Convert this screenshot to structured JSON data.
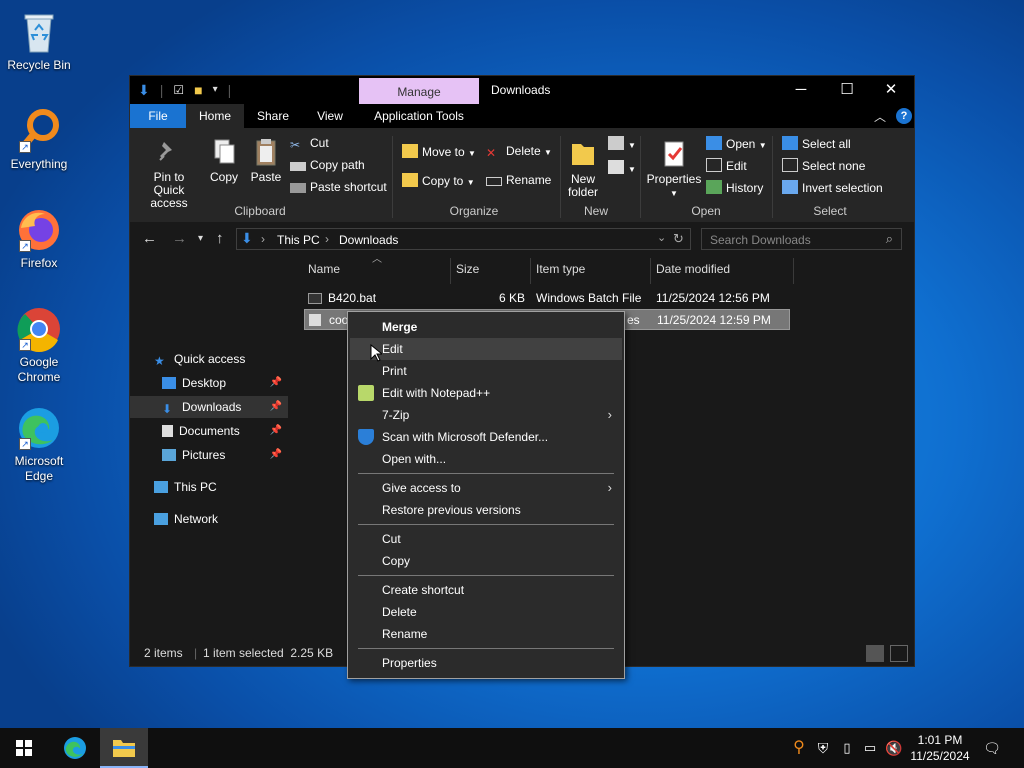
{
  "desktop": {
    "icons": [
      {
        "label": "Recycle Bin"
      },
      {
        "label": "Everything"
      },
      {
        "label": "Firefox"
      },
      {
        "label": "Google Chrome"
      },
      {
        "label": "Microsoft Edge"
      }
    ]
  },
  "window": {
    "title": "Downloads",
    "manage_tab": "Manage",
    "controls": {
      "minimize": "─",
      "maximize": "☐",
      "close": "✕"
    },
    "tabs": [
      "File",
      "Home",
      "Share",
      "View",
      "Application Tools"
    ],
    "ribbon": {
      "clipboard": {
        "pin": "Pin to Quick access",
        "copy": "Copy",
        "paste": "Paste",
        "cut": "Cut",
        "copy_path": "Copy path",
        "paste_shortcut": "Paste shortcut",
        "label": "Clipboard"
      },
      "organize": {
        "move_to": "Move to",
        "copy_to": "Copy to",
        "delete": "Delete",
        "rename": "Rename",
        "label": "Organize"
      },
      "new": {
        "new_folder": "New folder",
        "label": "New"
      },
      "open": {
        "properties": "Properties",
        "open": "Open",
        "edit": "Edit",
        "history": "History",
        "label": "Open"
      },
      "select": {
        "select_all": "Select all",
        "select_none": "Select none",
        "invert": "Invert selection",
        "label": "Select"
      }
    },
    "address": {
      "crumbs": [
        "This PC",
        "Downloads"
      ]
    },
    "search_placeholder": "Search Downloads",
    "navpane": {
      "quick_access": "Quick access",
      "items": [
        "Desktop",
        "Downloads",
        "Documents",
        "Pictures"
      ],
      "this_pc": "This PC",
      "network": "Network"
    },
    "columns": [
      "Name",
      "Size",
      "Item type",
      "Date modified"
    ],
    "files": [
      {
        "name": "B420.bat",
        "size": "6 KB",
        "type": "Windows Batch File",
        "date": "11/25/2024 12:56 PM"
      },
      {
        "name": "coo",
        "size": "",
        "type": "es",
        "date": "11/25/2024 12:59 PM"
      }
    ],
    "status": {
      "count": "2 items",
      "selected": "1 item selected  2.25 KB"
    }
  },
  "context_menu": {
    "merge": "Merge",
    "edit": "Edit",
    "print": "Print",
    "notepadpp": "Edit with Notepad++",
    "zip": "7-Zip",
    "defender": "Scan with Microsoft Defender...",
    "open_with": "Open with...",
    "give_access": "Give access to",
    "restore": "Restore previous versions",
    "cut": "Cut",
    "copy": "Copy",
    "create_shortcut": "Create shortcut",
    "delete": "Delete",
    "rename": "Rename",
    "properties": "Properties"
  },
  "taskbar": {
    "time": "1:01 PM",
    "date": "11/25/2024"
  },
  "colors": {
    "accent": "#1a73d1",
    "manage": "#e6c2f5"
  }
}
